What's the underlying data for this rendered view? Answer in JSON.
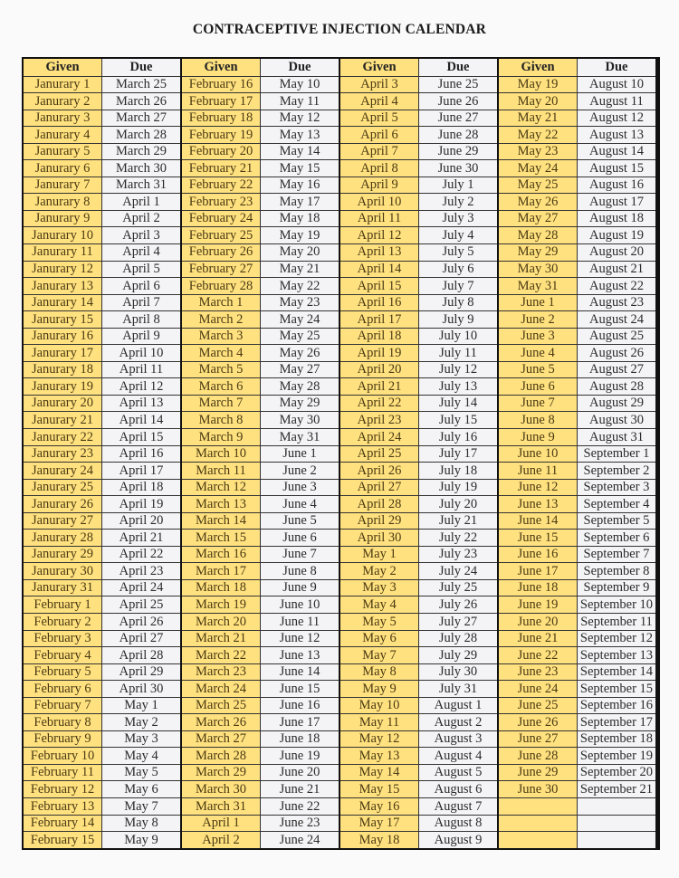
{
  "title": "CONTRACEPTIVE INJECTION CALENDAR",
  "headers": {
    "given": "Given",
    "due": "Due"
  },
  "colors": {
    "given_fill": "#ffe17f",
    "due_fill": "#f4f4f6",
    "border": "#111111"
  },
  "blocks": [
    {
      "rows": [
        [
          "Janurary 1",
          "March 25"
        ],
        [
          "Janurary 2",
          "March 26"
        ],
        [
          "Janurary 3",
          "March 27"
        ],
        [
          "Janurary 4",
          "March 28"
        ],
        [
          "Janurary 5",
          "March 29"
        ],
        [
          "Janurary 6",
          "March 30"
        ],
        [
          "Janurary 7",
          "March 31"
        ],
        [
          "Janurary 8",
          "April 1"
        ],
        [
          "Janurary 9",
          "April 2"
        ],
        [
          "Janurary 10",
          "April 3"
        ],
        [
          "Janurary 11",
          "April 4"
        ],
        [
          "Janurary 12",
          "April 5"
        ],
        [
          "Janurary 13",
          "April 6"
        ],
        [
          "Janurary 14",
          "April 7"
        ],
        [
          "Janurary 15",
          "April 8"
        ],
        [
          "Janurary 16",
          "April 9"
        ],
        [
          "Janurary 17",
          "April 10"
        ],
        [
          "Janurary 18",
          "April 11"
        ],
        [
          "Janurary 19",
          "April 12"
        ],
        [
          "Janurary 20",
          "April 13"
        ],
        [
          "Janurary 21",
          "April 14"
        ],
        [
          "Janurary 22",
          "April 15"
        ],
        [
          "Janurary 23",
          "April 16"
        ],
        [
          "Janurary 24",
          "April 17"
        ],
        [
          "Janurary 25",
          "April 18"
        ],
        [
          "Janurary 26",
          "April 19"
        ],
        [
          "Janurary 27",
          "April 20"
        ],
        [
          "Janurary 28",
          "April 21"
        ],
        [
          "Janurary 29",
          "April 22"
        ],
        [
          "Janurary 30",
          "April 23"
        ],
        [
          "Janurary 31",
          "April 24"
        ],
        [
          "February 1",
          "April 25"
        ],
        [
          "February 2",
          "April 26"
        ],
        [
          "February 3",
          "April 27"
        ],
        [
          "February 4",
          "April 28"
        ],
        [
          "February 5",
          "April 29"
        ],
        [
          "February 6",
          "April 30"
        ],
        [
          "February 7",
          "May 1"
        ],
        [
          "February 8",
          "May 2"
        ],
        [
          "February 9",
          "May 3"
        ],
        [
          "February 10",
          "May 4"
        ],
        [
          "February 11",
          "May 5"
        ],
        [
          "February 12",
          "May 6"
        ],
        [
          "February 13",
          "May 7"
        ],
        [
          "February 14",
          "May 8"
        ],
        [
          "February 15",
          "May 9"
        ]
      ]
    },
    {
      "rows": [
        [
          "February 16",
          "May 10"
        ],
        [
          "February 17",
          "May 11"
        ],
        [
          "February 18",
          "May 12"
        ],
        [
          "February 19",
          "May 13"
        ],
        [
          "February 20",
          "May 14"
        ],
        [
          "February 21",
          "May 15"
        ],
        [
          "February 22",
          "May 16"
        ],
        [
          "February 23",
          "May 17"
        ],
        [
          "February 24",
          "May 18"
        ],
        [
          "February 25",
          "May 19"
        ],
        [
          "February 26",
          "May 20"
        ],
        [
          "February 27",
          "May 21"
        ],
        [
          "February 28",
          "May 22"
        ],
        [
          "March 1",
          "May 23"
        ],
        [
          "March 2",
          "May 24"
        ],
        [
          "March 3",
          "May 25"
        ],
        [
          "March 4",
          "May 26"
        ],
        [
          "March 5",
          "May 27"
        ],
        [
          "March 6",
          "May 28"
        ],
        [
          "March 7",
          "May 29"
        ],
        [
          "March 8",
          "May 30"
        ],
        [
          "March 9",
          "May 31"
        ],
        [
          "March 10",
          "June 1"
        ],
        [
          "March 11",
          "June 2"
        ],
        [
          "March 12",
          "June 3"
        ],
        [
          "March 13",
          "June 4"
        ],
        [
          "March 14",
          "June 5"
        ],
        [
          "March 15",
          "June 6"
        ],
        [
          "March 16",
          "June 7"
        ],
        [
          "March 17",
          "June 8"
        ],
        [
          "March 18",
          "June 9"
        ],
        [
          "March 19",
          "June 10"
        ],
        [
          "March 20",
          "June 11"
        ],
        [
          "March 21",
          "June 12"
        ],
        [
          "March 22",
          "June 13"
        ],
        [
          "March 23",
          "June 14"
        ],
        [
          "March 24",
          "June 15"
        ],
        [
          "March 25",
          "June 16"
        ],
        [
          "March 26",
          "June 17"
        ],
        [
          "March 27",
          "June 18"
        ],
        [
          "March 28",
          "June 19"
        ],
        [
          "March 29",
          "June 20"
        ],
        [
          "March 30",
          "June 21"
        ],
        [
          "March 31",
          "June 22"
        ],
        [
          "April 1",
          "June 23"
        ],
        [
          "April 2",
          "June 24"
        ]
      ]
    },
    {
      "rows": [
        [
          "April 3",
          "June 25"
        ],
        [
          "April 4",
          "June 26"
        ],
        [
          "April 5",
          "June 27"
        ],
        [
          "April 6",
          "June 28"
        ],
        [
          "April 7",
          "June 29"
        ],
        [
          "April 8",
          "June 30"
        ],
        [
          "April 9",
          "July 1"
        ],
        [
          "April 10",
          "July 2"
        ],
        [
          "April 11",
          "July 3"
        ],
        [
          "April 12",
          "July 4"
        ],
        [
          "April 13",
          "July 5"
        ],
        [
          "April 14",
          "July 6"
        ],
        [
          "April 15",
          "July 7"
        ],
        [
          "April 16",
          "July 8"
        ],
        [
          "April 17",
          "July 9"
        ],
        [
          "April 18",
          "July 10"
        ],
        [
          "April 19",
          "July 11"
        ],
        [
          "April 20",
          "July 12"
        ],
        [
          "April 21",
          "July 13"
        ],
        [
          "April 22",
          "July 14"
        ],
        [
          "April 23",
          "July 15"
        ],
        [
          "April 24",
          "July 16"
        ],
        [
          "April 25",
          "July 17"
        ],
        [
          "April 26",
          "July 18"
        ],
        [
          "April 27",
          "July 19"
        ],
        [
          "April 28",
          "July 20"
        ],
        [
          "April 29",
          "July 21"
        ],
        [
          "April 30",
          "July 22"
        ],
        [
          "May 1",
          "July 23"
        ],
        [
          "May 2",
          "July 24"
        ],
        [
          "May 3",
          "July 25"
        ],
        [
          "May 4",
          "July 26"
        ],
        [
          "May 5",
          "July 27"
        ],
        [
          "May 6",
          "July 28"
        ],
        [
          "May 7",
          "July 29"
        ],
        [
          "May 8",
          "July 30"
        ],
        [
          "May 9",
          "July 31"
        ],
        [
          "May 10",
          "August 1"
        ],
        [
          "May 11",
          "August 2"
        ],
        [
          "May 12",
          "August 3"
        ],
        [
          "May 13",
          "August 4"
        ],
        [
          "May 14",
          "August 5"
        ],
        [
          "May 15",
          "August 6"
        ],
        [
          "May 16",
          "August 7"
        ],
        [
          "May 17",
          "August 8"
        ],
        [
          "May 18",
          "August 9"
        ]
      ]
    },
    {
      "rows": [
        [
          "May 19",
          "August 10"
        ],
        [
          "May 20",
          "August 11"
        ],
        [
          "May 21",
          "August 12"
        ],
        [
          "May 22",
          "August 13"
        ],
        [
          "May 23",
          "August 14"
        ],
        [
          "May 24",
          "August 15"
        ],
        [
          "May 25",
          "August 16"
        ],
        [
          "May 26",
          "August 17"
        ],
        [
          "May 27",
          "August 18"
        ],
        [
          "May 28",
          "August 19"
        ],
        [
          "May 29",
          "August 20"
        ],
        [
          "May 30",
          "August 21"
        ],
        [
          "May 31",
          "August 22"
        ],
        [
          "June 1",
          "August 23"
        ],
        [
          "June 2",
          "August 24"
        ],
        [
          "June 3",
          "August 25"
        ],
        [
          "June 4",
          "August 26"
        ],
        [
          "June 5",
          "August 27"
        ],
        [
          "June 6",
          "August 28"
        ],
        [
          "June 7",
          "August 29"
        ],
        [
          "June 8",
          "August 30"
        ],
        [
          "June 9",
          "August 31"
        ],
        [
          "June 10",
          "September 1"
        ],
        [
          "June 11",
          "September 2"
        ],
        [
          "June 12",
          "September 3"
        ],
        [
          "June 13",
          "September 4"
        ],
        [
          "June 14",
          "September 5"
        ],
        [
          "June 15",
          "September 6"
        ],
        [
          "June 16",
          "September 7"
        ],
        [
          "June 17",
          "September 8"
        ],
        [
          "June 18",
          "September 9"
        ],
        [
          "June 19",
          "September 10"
        ],
        [
          "June 20",
          "September 11"
        ],
        [
          "June 21",
          "September 12"
        ],
        [
          "June 22",
          "September 13"
        ],
        [
          "June 23",
          "September 14"
        ],
        [
          "June 24",
          "September 15"
        ],
        [
          "June 25",
          "September 16"
        ],
        [
          "June 26",
          "September 17"
        ],
        [
          "June 27",
          "September 18"
        ],
        [
          "June 28",
          "September 19"
        ],
        [
          "June 29",
          "September 20"
        ],
        [
          "June 30",
          "September 21"
        ],
        [
          "",
          ""
        ],
        [
          "",
          ""
        ],
        [
          "",
          ""
        ]
      ]
    }
  ]
}
